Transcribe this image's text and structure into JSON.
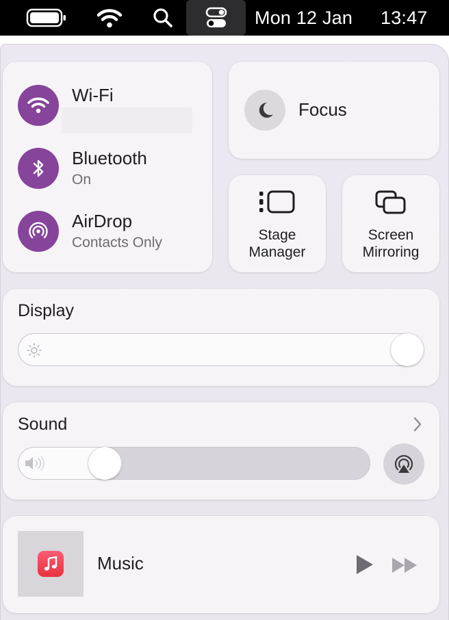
{
  "menubar": {
    "date": "Mon 12 Jan",
    "time": "13:47",
    "icons": [
      "battery-icon",
      "wifi-icon",
      "search-icon",
      "control-center-icon"
    ]
  },
  "network": {
    "wifi": {
      "label": "Wi-Fi",
      "status": ""
    },
    "bluetooth": {
      "label": "Bluetooth",
      "status": "On"
    },
    "airdrop": {
      "label": "AirDrop",
      "status": "Contacts Only"
    }
  },
  "focus": {
    "label": "Focus",
    "icon": "moon-icon"
  },
  "stage_manager": {
    "label_line1": "Stage",
    "label_line2": "Manager",
    "icon": "stage-manager-icon"
  },
  "screen_mirroring": {
    "label_line1": "Screen",
    "label_line2": "Mirroring",
    "icon": "screen-mirroring-icon"
  },
  "display": {
    "title": "Display",
    "brightness": 1.0
  },
  "sound": {
    "title": "Sound",
    "volume": 0.22
  },
  "music": {
    "label": "Music"
  },
  "colors": {
    "accent": "#86449a",
    "panel": "#ebe6ee",
    "tile": "#f7f5f9",
    "menubar": "#000000"
  }
}
